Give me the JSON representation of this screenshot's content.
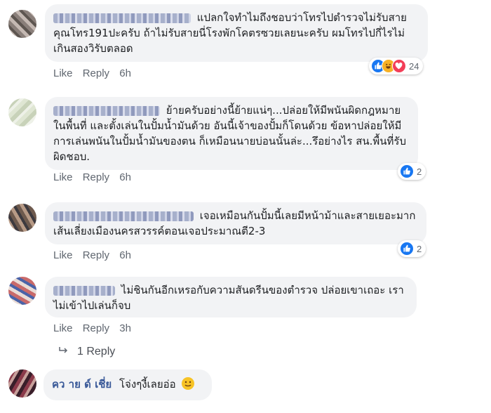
{
  "comments": [
    {
      "text": "แปลกใจทำไมถึงชอบว่าโทรไปตำรวจไม่รับสาย คุณโทร191ปะครับ ถ้าไม่รับสายนี่โรงพักโคตรซวยเลยนะครับ ผมโทรไปกี่ไรไม่เกินสองวิรับตลอด",
      "like": "Like",
      "reply": "Reply",
      "time": "6h",
      "reaction_count": "24",
      "reaction_icons": [
        "like-icon",
        "haha-icon",
        "love-icon"
      ]
    },
    {
      "text": "ย้ายครับอย่างนี้ย้ายแน่ๆ...ปล่อยให้มีพนันผิดกฎหมายในพื้นที่ และตั้งเล่นในปั้มน้ำมันด้วย อันนี้เจ้าของปั้มก็โดนด้วย ข้อหาปล่อยให้มีการเล่นพนันในปั้มน้ำมันของตน ก็เหมือนนายบ่อนนั้นล่ะ...รึอย่างไร สน.พื้นที่รับผิดชอบ.",
      "like": "Like",
      "reply": "Reply",
      "time": "6h",
      "reaction_count": "2",
      "reaction_icons": [
        "like-icon"
      ]
    },
    {
      "text": "เจอเหมือนกันปั้มนี้เลยมีหน้าม้าและสายเยอะมากเส้นเลี่ยงเมืองนครสวรรค์ตอนเจอประมาณตี2-3",
      "like": "Like",
      "reply": "Reply",
      "time": "6h",
      "reaction_count": "2",
      "reaction_icons": [
        "like-icon"
      ]
    },
    {
      "text": "ไม่ชินกันอีกเหรอกับความสันดรีนของตำรวจ ปล่อยเขาเถอะ เราไม่เข้าไปเล่นก็จบ",
      "like": "Like",
      "reply": "Reply",
      "time": "3h"
    }
  ],
  "replies_link": "1 Reply",
  "last_comment": {
    "name": "คว าย ด์ เชี่ย",
    "text": "โจ่งๆงี้เลยอ่อ",
    "emoji": "smile-emoji"
  },
  "colors": {
    "bubble": "#f2f3f5",
    "like_blue": "#1877f2",
    "name_blue": "#385898",
    "meta_gray": "#606770"
  }
}
